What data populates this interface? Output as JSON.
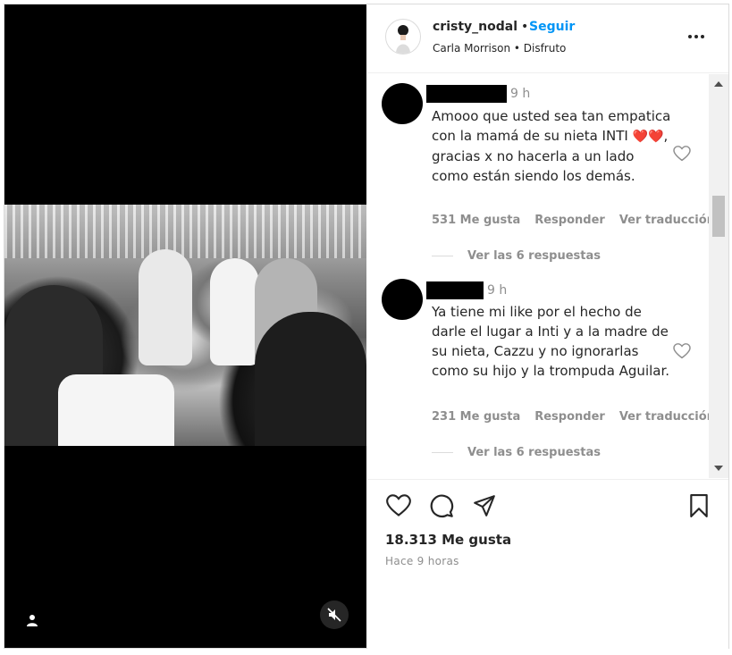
{
  "post": {
    "username": "cristy_nodal",
    "separator": "•",
    "follow_label": "Seguir",
    "audio": "Carla Morrison • Disfruto",
    "likes": "18.313 Me gusta",
    "time_ago": "Hace 9 horas"
  },
  "comments": [
    {
      "time": "9 h",
      "text_before": "Amooo que usted sea tan empatica con la mamá de su nieta INTI ",
      "emoji": "❤️❤️",
      "text_after": ", gracias x no hacerla a un lado como están siendo los demás.",
      "likes": "531 Me gusta",
      "reply_label": "Responder",
      "translate_label": "Ver traducción",
      "view_replies": "Ver las 6 respuestas"
    },
    {
      "time": "9 h",
      "text": "Ya tiene mi like por el hecho de darle el lugar a Inti y a la madre de su nieta, Cazzu y no ignorarlas como su hijo y la trompuda Aguilar.",
      "likes": "231 Me gusta",
      "reply_label": "Responder",
      "translate_label": "Ver traducción",
      "view_replies": "Ver las 6 respuestas"
    }
  ],
  "colors": {
    "follow": "#0095f6",
    "heart": "#ed4956",
    "muted_text": "#8e8e8e"
  },
  "icons": [
    "user-tag-icon",
    "mute-icon",
    "more-options-icon",
    "like-icon",
    "comment-icon",
    "share-icon",
    "save-icon"
  ]
}
